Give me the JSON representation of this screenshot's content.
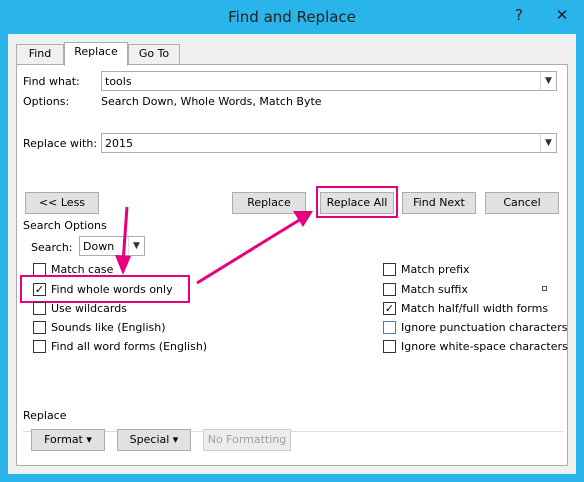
{
  "window": {
    "title": "Find and Replace",
    "help_label": "?",
    "close_label": "✕"
  },
  "tabs": [
    {
      "label": "Find"
    },
    {
      "label": "Replace"
    },
    {
      "label": "Go To"
    }
  ],
  "find": {
    "label": "Find what:",
    "value": "tools",
    "options_label": "Options:",
    "options_value": "Search Down, Whole Words, Match Byte"
  },
  "replace": {
    "label": "Replace with:",
    "value": "2015"
  },
  "buttons": {
    "less": "<< Less",
    "replace": "Replace",
    "replace_all": "Replace All",
    "find_next": "Find Next",
    "cancel": "Cancel"
  },
  "search_options": {
    "heading": "Search Options",
    "search_label": "Search:",
    "search_value": "Down",
    "left": [
      {
        "label": "Match case",
        "checked": false
      },
      {
        "label": "Find whole words only",
        "checked": true
      },
      {
        "label": "Use wildcards",
        "checked": false
      },
      {
        "label": "Sounds like (English)",
        "checked": false
      },
      {
        "label": "Find all word forms (English)",
        "checked": false
      }
    ],
    "right": [
      {
        "label": "Match prefix",
        "checked": false
      },
      {
        "label": "Match suffix",
        "checked": false
      },
      {
        "label": "Match half/full width forms",
        "checked": true
      },
      {
        "label": "Ignore punctuation characters",
        "checked": false
      },
      {
        "label": "Ignore white-space characters",
        "checked": false
      }
    ]
  },
  "replace_section": {
    "heading": "Replace",
    "format": "Format ▾",
    "special": "Special ▾",
    "no_formatting": "No Formatting"
  },
  "colors": {
    "titlebar": "#29b5ea",
    "highlight": "#e6007e"
  }
}
